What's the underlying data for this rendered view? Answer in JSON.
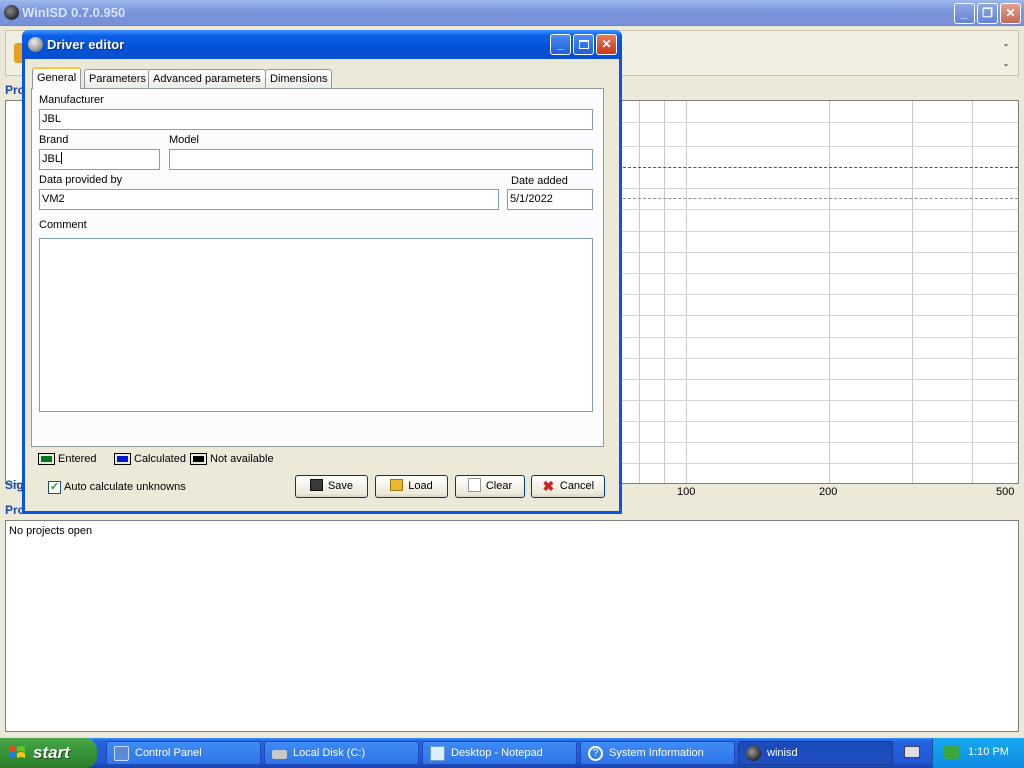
{
  "main_window": {
    "title": "WinISD 0.7.0.950",
    "buttons": {
      "minimize": "_",
      "restore": "❐",
      "close": "✕"
    },
    "toolbar_dashes": [
      "-",
      "-"
    ],
    "section_labels": {
      "top": "Pro",
      "signal": "Sig",
      "projects": "Pro"
    },
    "graph": {
      "x_ticks": [
        "100",
        "200",
        "500"
      ]
    },
    "projects_empty_text": "No projects open"
  },
  "dialog": {
    "title": "Driver editor",
    "tabs": [
      "General",
      "Parameters",
      "Advanced parameters",
      "Dimensions"
    ],
    "active_tab": "General",
    "fields": {
      "manufacturer": {
        "label": "Manufacturer",
        "value": "JBL"
      },
      "brand": {
        "label": "Brand",
        "value": "JBL"
      },
      "model": {
        "label": "Model",
        "value": ""
      },
      "data_provided_by": {
        "label": "Data provided by",
        "value": "VM2"
      },
      "date_added": {
        "label": "Date added",
        "value": "5/1/2022"
      },
      "comment": {
        "label": "Comment",
        "value": ""
      }
    },
    "legend": [
      {
        "label": "Entered",
        "color": "#007a1e"
      },
      {
        "label": "Calculated",
        "color": "#0018d6"
      },
      {
        "label": "Not available",
        "color": "#000000"
      }
    ],
    "auto_calculate": {
      "label": "Auto calculate unknowns",
      "checked": true,
      "mark": "✓"
    },
    "buttons": {
      "save": "Save",
      "load": "Load",
      "clear": "Clear",
      "cancel": "Cancel"
    }
  },
  "taskbar": {
    "start_label": "start",
    "items": [
      {
        "label": "Control Panel",
        "icon": "control-panel-icon"
      },
      {
        "label": "Local Disk (C:)",
        "icon": "drive-icon"
      },
      {
        "label": "Desktop - Notepad",
        "icon": "notepad-icon"
      },
      {
        "label": "System Information",
        "icon": "help-icon"
      },
      {
        "label": "winisd",
        "icon": "winisd-icon",
        "active": true
      }
    ],
    "clock": "1:10 PM"
  }
}
